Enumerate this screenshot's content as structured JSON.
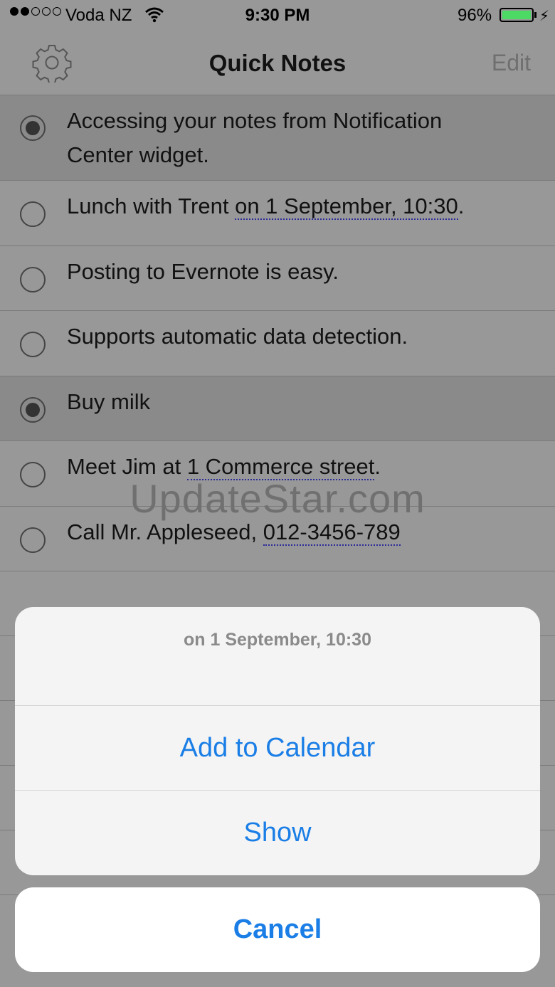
{
  "status_bar": {
    "carrier": "Voda NZ",
    "time": "9:30 PM",
    "battery": "96%",
    "signal_bars": 2,
    "battery_color": "#4cd964"
  },
  "nav": {
    "title": "Quick Notes",
    "edit_label": "Edit",
    "settings_icon": "gear-icon"
  },
  "notes": [
    {
      "checked": true,
      "lines": [
        "Accessing your notes from Notification",
        "Center widget."
      ]
    },
    {
      "checked": false,
      "prefix": "Lunch with Trent ",
      "link": "on 1 September, 10:30",
      "suffix": "."
    },
    {
      "checked": false,
      "text": "Posting to Evernote is easy."
    },
    {
      "checked": false,
      "text": "Supports automatic data detection."
    },
    {
      "checked": true,
      "text": "Buy milk"
    },
    {
      "checked": false,
      "prefix": "Meet Jim at ",
      "link": "1 Commerce street",
      "suffix": "."
    },
    {
      "checked": false,
      "prefix": "Call Mr. Appleseed, ",
      "link": "012-3456-789",
      "suffix": ""
    }
  ],
  "watermark": "UpdateStar.com",
  "action_sheet": {
    "title": "on 1 September, 10:30",
    "actions": [
      "Add to Calendar",
      "Show"
    ],
    "cancel": "Cancel",
    "accent_color": "#1a7ee6"
  }
}
